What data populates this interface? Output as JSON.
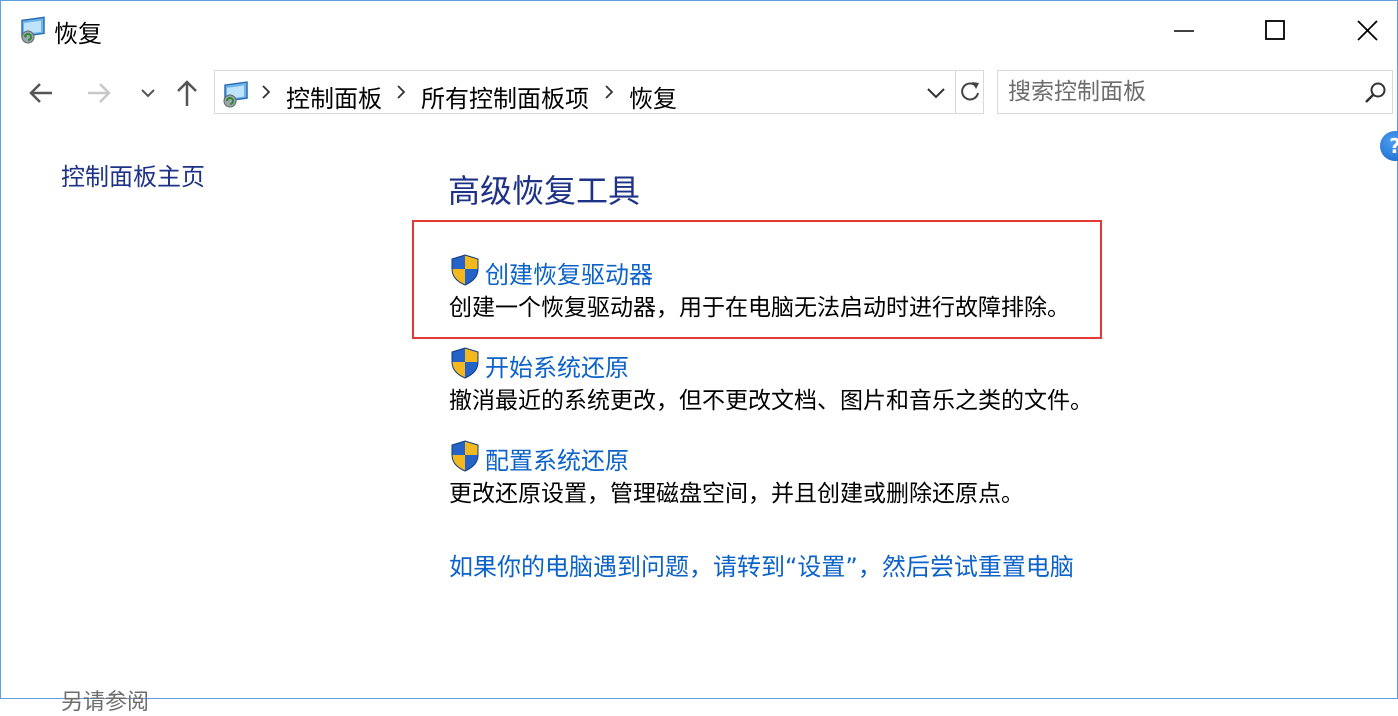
{
  "window": {
    "title": "恢复",
    "icon": "control-panel-recovery-icon"
  },
  "navigation": {
    "back_icon": "arrow-left-icon",
    "forward_icon": "arrow-right-icon",
    "recent_icon": "chevron-down-icon",
    "up_icon": "arrow-up-icon",
    "breadcrumbs": [
      "控制面板",
      "所有控制面板项",
      "恢复"
    ]
  },
  "search": {
    "placeholder": "搜索控制面板"
  },
  "sidebar": {
    "home_link": "控制面板主页",
    "see_also": "另请参阅"
  },
  "main": {
    "title": "高级恢复工具",
    "tasks": [
      {
        "label": "创建恢复驱动器",
        "description": "创建一个恢复驱动器，用于在电脑无法启动时进行故障排除。",
        "icon": "uac-shield-icon"
      },
      {
        "label": "开始系统还原",
        "description": "撤消最近的系统更改，但不更改文档、图片和音乐之类的文件。",
        "icon": "uac-shield-icon"
      },
      {
        "label": "配置系统还原",
        "description": "更改还原设置，管理磁盘空间，并且创建或删除还原点。",
        "icon": "uac-shield-icon"
      }
    ],
    "reset_link": "如果你的电脑遇到问题，请转到“设置”，然后尝试重置电脑"
  },
  "colors": {
    "link": "#0b62c8",
    "heading": "#1e3287",
    "highlight_border": "#e53935",
    "window_border": "#5f9ee0"
  }
}
